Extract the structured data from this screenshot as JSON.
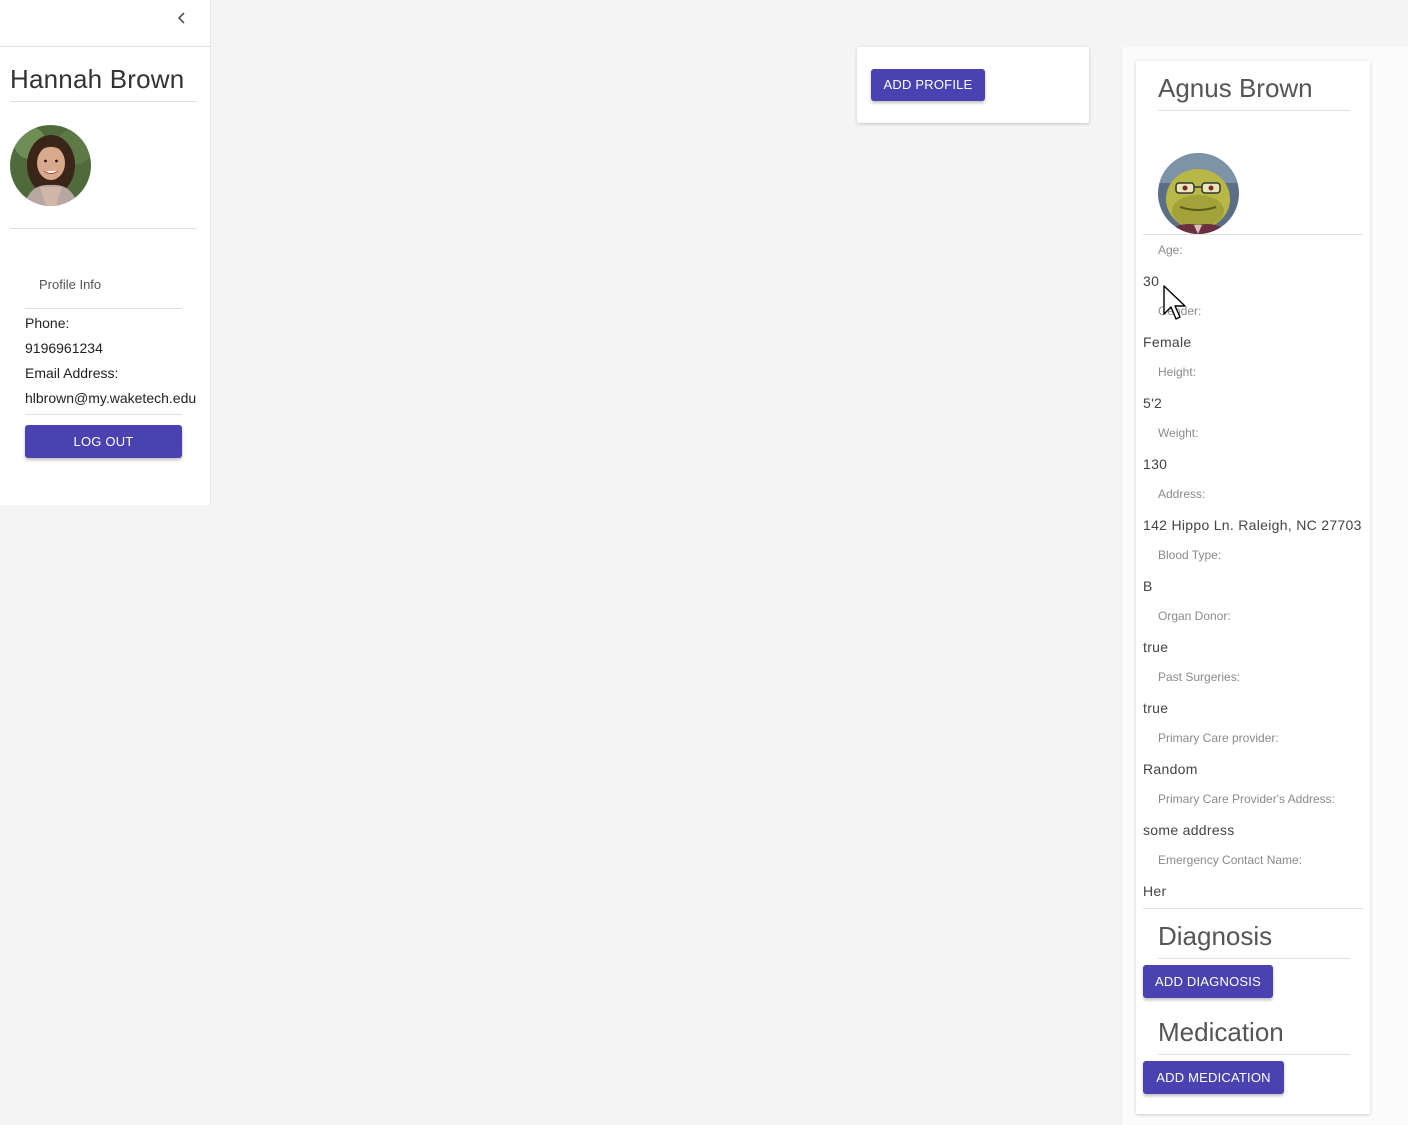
{
  "sidebar": {
    "user_name": "Hannah Brown",
    "section_title": "Profile Info",
    "phone_label": "Phone:",
    "phone_value": "9196961234",
    "email_label": "Email Address:",
    "email_value": "hlbrown@my.waketech.edu",
    "logout_label": "LOG OUT"
  },
  "main": {
    "add_profile_label": "ADD PROFILE"
  },
  "profile": {
    "name": "Agnus Brown",
    "fields": [
      {
        "label": "Age:",
        "value": "30"
      },
      {
        "label": "Gender:",
        "value": "Female"
      },
      {
        "label": "Height:",
        "value": "5'2"
      },
      {
        "label": "Weight:",
        "value": "130"
      },
      {
        "label": "Address:",
        "value": "142 Hippo Ln. Raleigh, NC 27703"
      },
      {
        "label": "Blood Type:",
        "value": "B"
      },
      {
        "label": "Organ Donor:",
        "value": "true"
      },
      {
        "label": "Past Surgeries:",
        "value": "true"
      },
      {
        "label": "Primary Care provider:",
        "value": "Random"
      },
      {
        "label": "Primary Care Provider's Address:",
        "value": "some address"
      },
      {
        "label": "Emergency Contact Name:",
        "value": "Her"
      }
    ],
    "diagnosis_title": "Diagnosis",
    "add_diagnosis_label": "ADD DIAGNOSIS",
    "medication_title": "Medication",
    "add_medication_label": "ADD MEDICATION"
  },
  "colors": {
    "accent": "#4a42b0",
    "background": "#f4f4f4"
  },
  "icons": {
    "collapse": "chevron-left-icon",
    "cursor": "mouse-pointer-icon"
  }
}
